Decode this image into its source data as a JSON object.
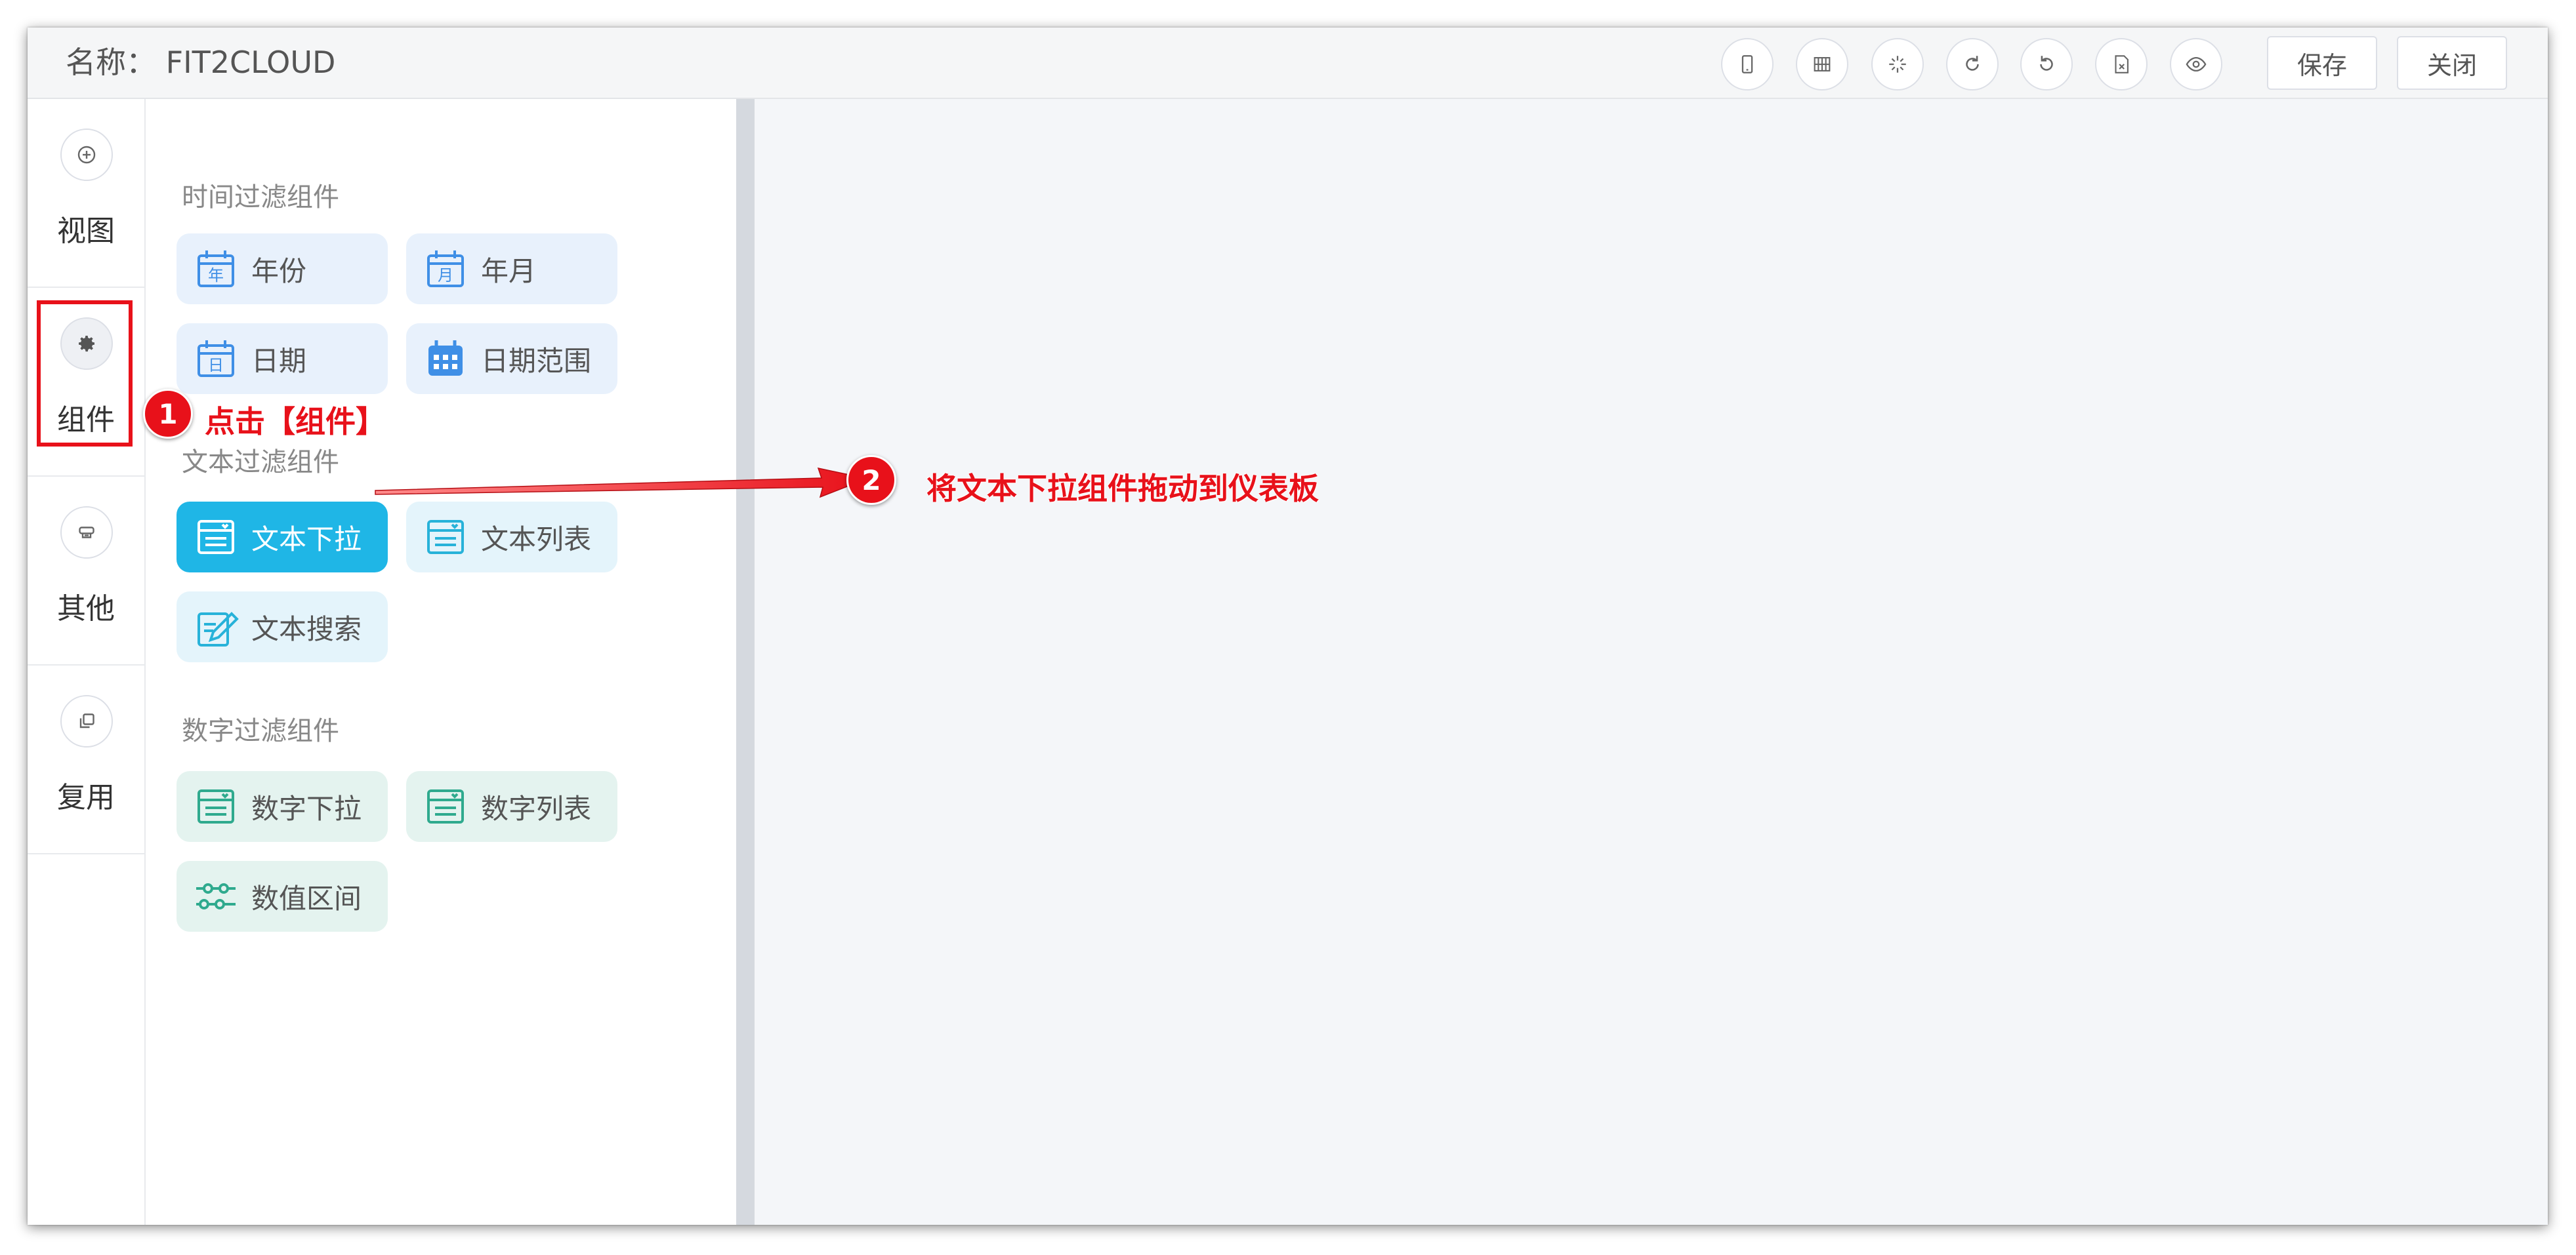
{
  "header": {
    "title": "名称： FIT2CLOUD",
    "toolbar_icons": [
      "mobile-icon",
      "grid-icon",
      "sparkle-icon",
      "redo-icon",
      "undo-icon",
      "export-icon",
      "preview-eye-icon"
    ],
    "save_label": "保存",
    "close_label": "关闭"
  },
  "rail": {
    "items": [
      {
        "label": "视图",
        "icon": "plus-icon"
      },
      {
        "label": "组件",
        "icon": "gear-icon"
      },
      {
        "label": "其他",
        "icon": "other-icon"
      },
      {
        "label": "复用",
        "icon": "copy-icon"
      }
    ]
  },
  "panel": {
    "time_section": "时间过滤组件",
    "time_items": [
      "年份",
      "年月",
      "日期",
      "日期范围"
    ],
    "text_section": "文本过滤组件",
    "text_items": [
      "文本下拉",
      "文本列表",
      "文本搜索"
    ],
    "number_section": "数字过滤组件",
    "number_items": [
      "数字下拉",
      "数字列表",
      "数值区间"
    ]
  },
  "annotations": {
    "step1_num": "1",
    "step1_text": "点击【组件】",
    "step2_num": "2",
    "step2_text": "将文本下拉组件拖动到仪表板"
  },
  "colors": {
    "accent": "#1fb6e6",
    "annotation_red": "#e8111a"
  }
}
